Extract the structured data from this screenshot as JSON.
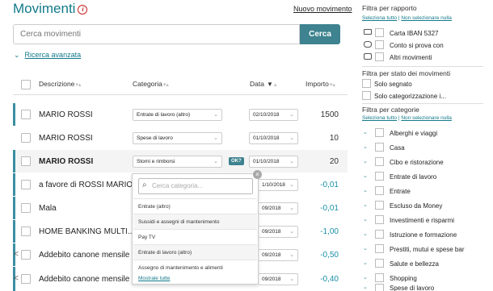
{
  "header": {
    "title": "Movimenti",
    "info_icon": "i",
    "new_link": "Nuovo movimento"
  },
  "search": {
    "placeholder": "Cerca movimenti",
    "button": "Cerca",
    "advanced": "Ricerca avanzata"
  },
  "table": {
    "columns": {
      "descrizione": "Descrizione",
      "categoria": "Categoria",
      "data": "Data",
      "importo": "Importo"
    },
    "rows": [
      {
        "desc": "MARIO ROSSI",
        "category": "Entrate di lavoro (altro)",
        "date": "02/10/2018",
        "amount": "1500"
      },
      {
        "desc": "MARIO ROSSI",
        "category": "Spese di lavoro",
        "date": "01/10/2018",
        "amount": "10"
      },
      {
        "desc": "MARIO ROSSI",
        "category": "Storni e rimborsi",
        "date": "01/10/2018",
        "amount": "20",
        "ok": "OK?"
      },
      {
        "desc": "a favore di  ROSSI MARIO",
        "date": "1/10/2018",
        "amount": "-0,01"
      },
      {
        "desc": "Mala",
        "date": "09/2018",
        "amount": "-0,01"
      },
      {
        "desc": "HOME BANKING MULTI...",
        "date": "09/2018",
        "amount": "-1,00"
      },
      {
        "desc": "Addebito canone mensile ...",
        "date": "09/2018",
        "amount": "-0,50"
      },
      {
        "desc": "Addebito canone mensile ...",
        "date": "09/2018",
        "amount": "-0,40"
      }
    ]
  },
  "dropdown": {
    "search_placeholder": "Cerca categoria...",
    "options": [
      "Entrate (altro)",
      "Sussidi e assegni di mantenimento",
      "Pay TV",
      "Entrate di lavoro (altro)",
      "Assegno di mantenimento e alimenti"
    ],
    "show_all": "Mostrale tutte"
  },
  "sidebar": {
    "report": {
      "title": "Filtra per rapporto",
      "select_all": "Seleziona tutto",
      "separator": "|",
      "select_none": "Non selezionare nulla",
      "items": [
        {
          "label": "Carta IBAN 5327",
          "icon": "card-icon"
        },
        {
          "label": "Conto si prova con",
          "icon": "piggy-bank-icon"
        },
        {
          "label": "Altri movimenti",
          "icon": "wallet-icon"
        }
      ]
    },
    "status": {
      "title": "Filtra per stato dei movimenti",
      "items": [
        "Solo segnato",
        "Solo categorizzazione i..."
      ]
    },
    "categories": {
      "title": "Filtra per categorie",
      "select_all": "Seleziona tutto",
      "separator": "|",
      "select_none": "Non selezionare nulla",
      "items": [
        "Alberghi e viaggi",
        "Casa",
        "Cibo e ristorazione",
        "Entrate di lavoro",
        "Entrate",
        "Escluso da Money",
        "Investimenti e risparmi",
        "Istruzione e formazione",
        "Prestiti, mutui e spese bar",
        "Salute e bellezza",
        "Shopping",
        "Spese di lavoro"
      ]
    }
  },
  "colors": {
    "accent": "#127a8a",
    "button": "#3e838f",
    "negative_amount": "#1a8fa8"
  }
}
